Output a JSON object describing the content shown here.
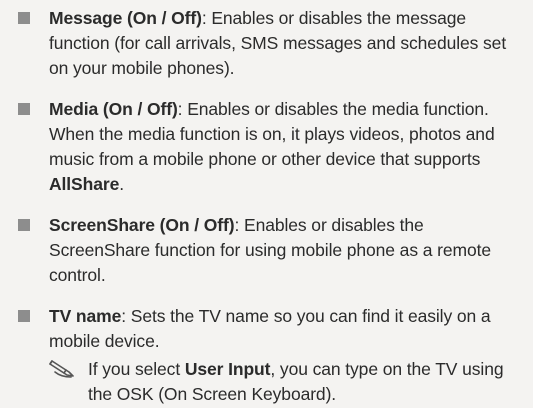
{
  "items": [
    {
      "term": "Message (On / Off)",
      "text": ": Enables or disables the message function (for call arrivals, SMS messages and schedules set on your mobile phones)."
    },
    {
      "term": "Media (On / Off)",
      "text_before": ": Enables or disables the media function. When the media function is on, it plays videos, photos and music from a mobile phone or other device that supports ",
      "emphasis": "AllShare",
      "text_after": "."
    },
    {
      "term": "ScreenShare (On / Off)",
      "text": ": Enables or disables the ScreenShare function for using mobile phone as a remote control."
    },
    {
      "term": "TV name",
      "text": ": Sets the TV name so you can find it easily on a mobile device.",
      "note": {
        "icon": "pencil-note-icon",
        "text_before": "If you select ",
        "emphasis": "User Input",
        "text_after": ", you can type on the TV using the OSK (On Screen Keyboard)."
      }
    }
  ],
  "colors": {
    "background": "#f4f3f1",
    "text": "#2b2b2b",
    "bullet": "#8d8d8d"
  }
}
